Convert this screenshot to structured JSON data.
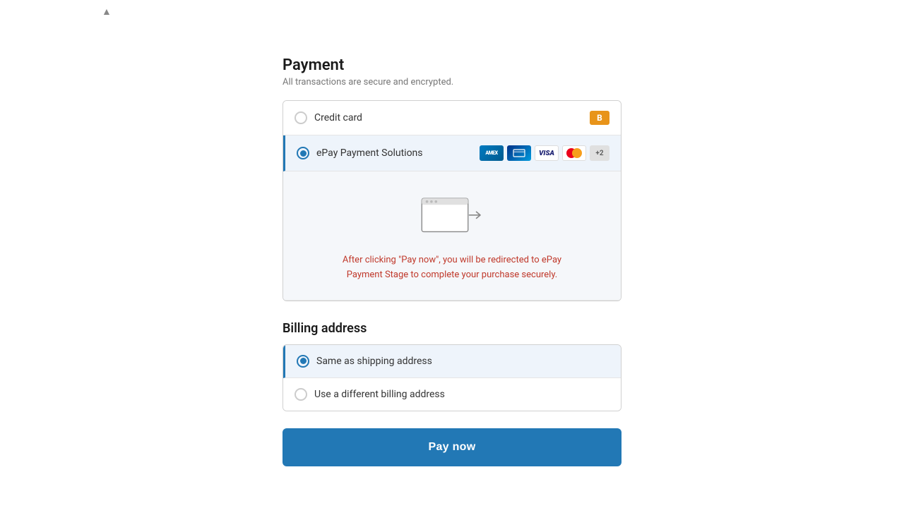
{
  "chevron": "▲",
  "payment": {
    "title": "Payment",
    "subtitle": "All transactions are secure and encrypted.",
    "options": [
      {
        "id": "credit-card",
        "label": "Credit card",
        "selected": false,
        "badge": "B"
      },
      {
        "id": "epay",
        "label": "ePay Payment Solutions",
        "selected": true
      }
    ],
    "redirect_text_part1": "After clicking \"Pay now\", you will be redirected to ePay",
    "redirect_text_part2": "Payment Stage to complete your purchase securely.",
    "plus_more": "+2"
  },
  "billing": {
    "title": "Billing address",
    "options": [
      {
        "id": "same-shipping",
        "label": "Same as shipping address",
        "selected": true
      },
      {
        "id": "different-billing",
        "label": "Use a different billing address",
        "selected": false
      }
    ]
  },
  "pay_button": {
    "label": "Pay now"
  }
}
